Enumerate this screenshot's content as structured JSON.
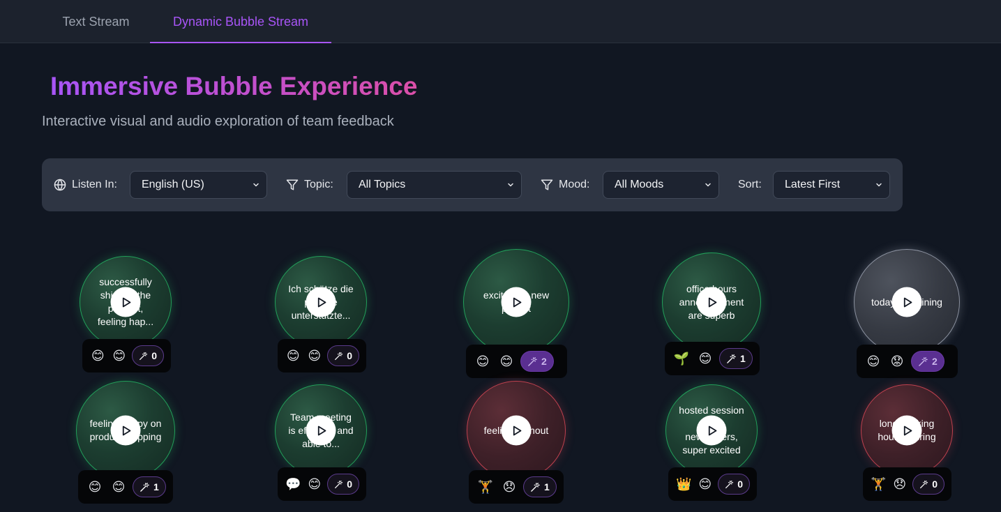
{
  "tabs": [
    {
      "label": "Text Stream",
      "active": false
    },
    {
      "label": "Dynamic Bubble Stream",
      "active": true
    }
  ],
  "header": {
    "title": "Immersive Bubble Experience",
    "subtitle": "Interactive visual and audio exploration of team feedback"
  },
  "filters": {
    "listen_label": "Listen In:",
    "listen_value": "English (US)",
    "topic_label": "Topic:",
    "topic_value": "All Topics",
    "mood_label": "Mood:",
    "mood_value": "All Moods",
    "sort_label": "Sort:",
    "sort_value": "Latest First"
  },
  "colors": {
    "accent": "#a855f7",
    "background": "#111722",
    "positive": "#22a05a",
    "negative": "#c0414f",
    "neutral": "#8c92a0"
  },
  "bubbles": [
    {
      "text": "successfully shipped the product, feeling hap...",
      "mood": "positive",
      "reactions": [
        "😊",
        "😊"
      ],
      "sparkles": "0"
    },
    {
      "text": "Ich schätze die positive unterstützte...",
      "mood": "positive",
      "reactions": [
        "😊",
        "😊"
      ],
      "sparkles": "0"
    },
    {
      "text": "excited for new project",
      "mood": "positive",
      "reactions": [
        "😊",
        "😊"
      ],
      "sparkles": "2"
    },
    {
      "text": "office hours announcement are superb",
      "mood": "positive",
      "reactions": [
        "🌱",
        "😊"
      ],
      "sparkles": "1"
    },
    {
      "text": "today is draining",
      "mood": "neutral",
      "reactions": [
        "😊",
        "😟"
      ],
      "sparkles": "2"
    },
    {
      "text": "feeling happy on product shipping",
      "mood": "positive",
      "reactions": [
        "😊",
        "😊"
      ],
      "sparkles": "1"
    },
    {
      "text": "Team meeting is effective and able to...",
      "mood": "positive",
      "reactions": [
        "💬",
        "😊"
      ],
      "sparkles": "0"
    },
    {
      "text": "feeling burnout",
      "mood": "negative",
      "reactions": [
        "🏋",
        "😞"
      ],
      "sparkles": "1"
    },
    {
      "text": "hosted session for newcomers, super excited",
      "mood": "positive",
      "reactions": [
        "👑",
        "😊"
      ],
      "sparkles": "0"
    },
    {
      "text": "long working hours is tiring",
      "mood": "negative",
      "reactions": [
        "🏋",
        "😞"
      ],
      "sparkles": "0"
    }
  ]
}
